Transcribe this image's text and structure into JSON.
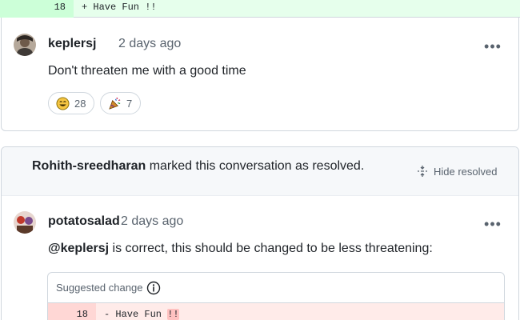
{
  "diff_top": {
    "line_number": "18",
    "code": "+ Have Fun !!"
  },
  "comment1": {
    "author": "keplersj",
    "time": "2 days ago",
    "body": "Don't threaten me with a good time",
    "reactions": [
      {
        "icon": "smile-icon",
        "count": "28"
      },
      {
        "icon": "party-popper-icon",
        "count": "7"
      }
    ]
  },
  "resolved": {
    "user": "Rohith-sreedharan",
    "text": " marked this conversation as resolved.",
    "hide_label": "Hide resolved"
  },
  "comment2": {
    "author": "potatosalad",
    "time": "2 days ago",
    "mention": "@keplersj",
    "body": " is correct, this should be changed to be less threatening:",
    "suggestion": {
      "header": "Suggested change",
      "line_number": "18",
      "code_prefix": "- Have Fun ",
      "code_highlight": "!!"
    }
  }
}
